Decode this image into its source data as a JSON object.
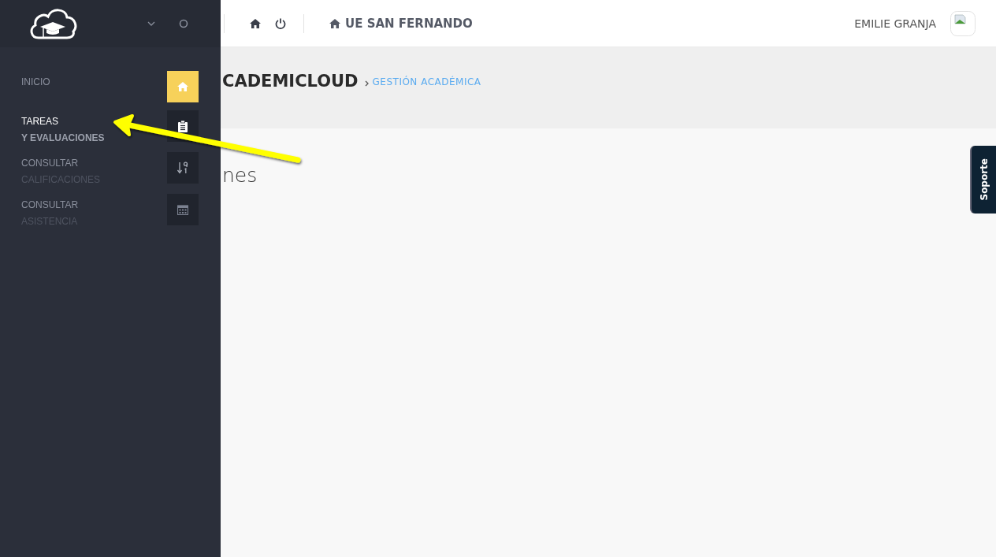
{
  "topbar": {
    "school": "UE SAN FERNANDO",
    "user": "EMILIE GRANJA"
  },
  "sidebar": {
    "items": [
      {
        "kind": "home",
        "lines": [
          "INICIO"
        ],
        "selected": true,
        "highlighted": false
      },
      {
        "kind": "clipboard",
        "lines": [
          "TAREAS",
          "Y EVALUACIONES"
        ],
        "selected": false,
        "highlighted": true
      },
      {
        "kind": "sort",
        "lines": [
          "CONSULTAR",
          "CALIFICACIONES"
        ],
        "selected": false,
        "highlighted": false
      },
      {
        "kind": "calendar",
        "lines": [
          "CONSULTAR",
          "ASISTENCIA"
        ],
        "selected": false,
        "highlighted": false
      }
    ]
  },
  "header": {
    "title": "CADEMICLOUD",
    "breadcrumb": "GESTIÓN ACADÉMICA"
  },
  "content": {
    "heading": "nes"
  },
  "support_tab": "Soporte"
}
